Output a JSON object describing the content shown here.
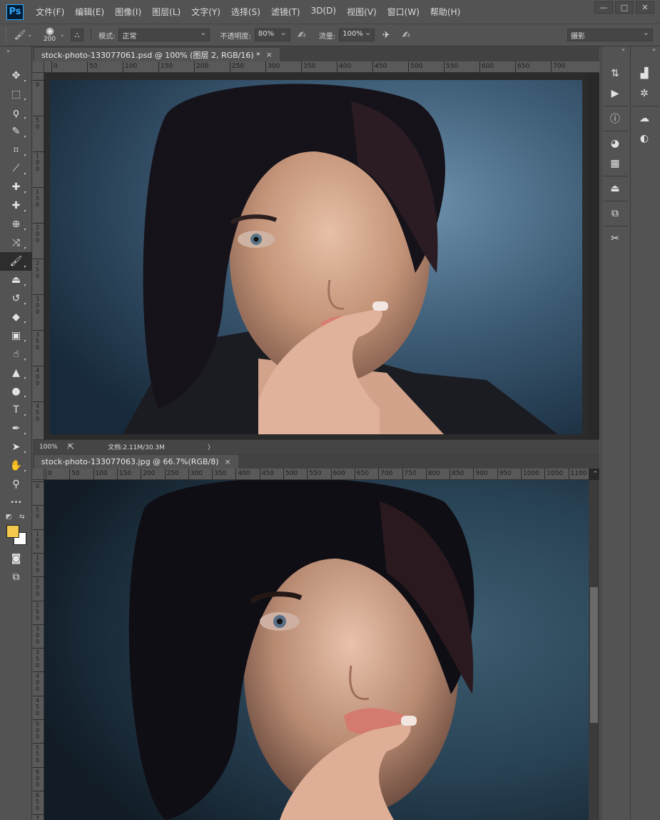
{
  "app": {
    "logo": "Ps"
  },
  "menu": [
    "文件(F)",
    "编辑(E)",
    "图像(I)",
    "图层(L)",
    "文字(Y)",
    "选择(S)",
    "滤镜(T)",
    "3D(D)",
    "视图(V)",
    "窗口(W)",
    "帮助(H)"
  ],
  "window_controls": [
    "—",
    "□",
    "✕"
  ],
  "options": {
    "brush_size": "200",
    "mode_label": "模式:",
    "mode_value": "正常",
    "opacity_label": "不透明度:",
    "opacity_value": "80%",
    "flow_label": "流量:",
    "flow_value": "100%",
    "workspace": "摄影"
  },
  "doc1": {
    "tab_title": "stock-photo-133077061.psd @ 100% (图层 2, RGB/16) *",
    "tab_close": "×",
    "ruler_labels": [
      "0",
      "50",
      "100",
      "150",
      "200",
      "250",
      "300",
      "350",
      "400",
      "450",
      "500",
      "550",
      "600",
      "650",
      "700"
    ],
    "vruler_labels": [
      "0",
      "5\n0",
      "1\n0\n0",
      "1\n5\n0",
      "2\n0\n0",
      "2\n5\n0",
      "3\n0\n0",
      "3\n5\n0",
      "4\n0\n0",
      "4\n5\n0"
    ],
    "zoom": "100%",
    "doc_info": "文档:2.11M/30.3M",
    "status_arrow": "〉"
  },
  "doc2": {
    "tab_title": "stock-photo-133077063.jpg @ 66.7%(RGB/8)",
    "tab_close": "×",
    "ruler_labels": [
      "0",
      "50",
      "100",
      "150",
      "200",
      "250",
      "300",
      "350",
      "400",
      "450",
      "500",
      "550",
      "600",
      "650",
      "700",
      "750",
      "800",
      "850",
      "900",
      "950",
      "1000",
      "1050",
      "1100"
    ],
    "vruler_labels": [
      "0",
      "5\n0",
      "1\n0\n0",
      "1\n5\n0",
      "2\n0\n0",
      "2\n5\n0",
      "3\n0\n0",
      "3\n5\n0",
      "4\n0\n0",
      "4\n5\n0",
      "5\n0\n0",
      "5\n5\n0",
      "6\n0\n0",
      "6\n5\n0",
      "7\n0\n0"
    ]
  },
  "tools": [
    {
      "name": "move-tool",
      "glyph": "✥"
    },
    {
      "name": "marquee-tool",
      "glyph": "⬚"
    },
    {
      "name": "lasso-tool",
      "glyph": "ϙ"
    },
    {
      "name": "quick-select-tool",
      "glyph": "✎"
    },
    {
      "name": "crop-tool",
      "glyph": "⌗"
    },
    {
      "name": "eyedropper-tool",
      "glyph": "⟋"
    },
    {
      "name": "healing-tool",
      "glyph": "✚"
    },
    {
      "name": "patch-tool",
      "glyph": "✚"
    },
    {
      "name": "red-eye-tool",
      "glyph": "⊕"
    },
    {
      "name": "content-aware-move-tool",
      "glyph": "⤨"
    },
    {
      "name": "brush-tool",
      "glyph": "🖌",
      "active": true
    },
    {
      "name": "clone-stamp-tool",
      "glyph": "⏏"
    },
    {
      "name": "history-brush-tool",
      "glyph": "↺"
    },
    {
      "name": "eraser-tool",
      "glyph": "◆"
    },
    {
      "name": "gradient-tool",
      "glyph": "▣"
    },
    {
      "name": "smudge-tool",
      "glyph": "☝"
    },
    {
      "name": "sharpen-tool",
      "glyph": "▲"
    },
    {
      "name": "dodge-tool",
      "glyph": "●"
    },
    {
      "name": "type-tool",
      "glyph": "T"
    },
    {
      "name": "pen-tool",
      "glyph": "✒"
    },
    {
      "name": "path-select-tool",
      "glyph": "➤"
    },
    {
      "name": "hand-tool",
      "glyph": "✋"
    },
    {
      "name": "zoom-tool",
      "glyph": "⚲"
    },
    {
      "name": "more-tools",
      "glyph": "•••"
    }
  ],
  "colors": {
    "foreground": "#f2c94c",
    "background": "#ffffff",
    "accent": "#31a8ff"
  },
  "dock1": [
    {
      "name": "history-panel-icon",
      "glyph": "⇅"
    },
    {
      "name": "actions-panel-icon",
      "glyph": "▶"
    },
    {
      "name": "info-panel-icon",
      "glyph": "ⓘ"
    },
    {
      "name": "color-panel-icon",
      "glyph": "◕"
    },
    {
      "name": "swatches-panel-icon",
      "glyph": "▦"
    },
    {
      "name": "clone-source-panel-icon",
      "glyph": "⏏"
    },
    {
      "name": "paths-panel-icon",
      "glyph": "⧉"
    },
    {
      "name": "tool-presets-panel-icon",
      "glyph": "✂"
    }
  ],
  "dock2": [
    {
      "name": "histogram-panel-icon",
      "glyph": "▟"
    },
    {
      "name": "navigator-panel-icon",
      "glyph": "✲"
    },
    {
      "name": "libraries-panel-icon",
      "glyph": "☁"
    },
    {
      "name": "adjustments-panel-icon",
      "glyph": "◐"
    }
  ]
}
